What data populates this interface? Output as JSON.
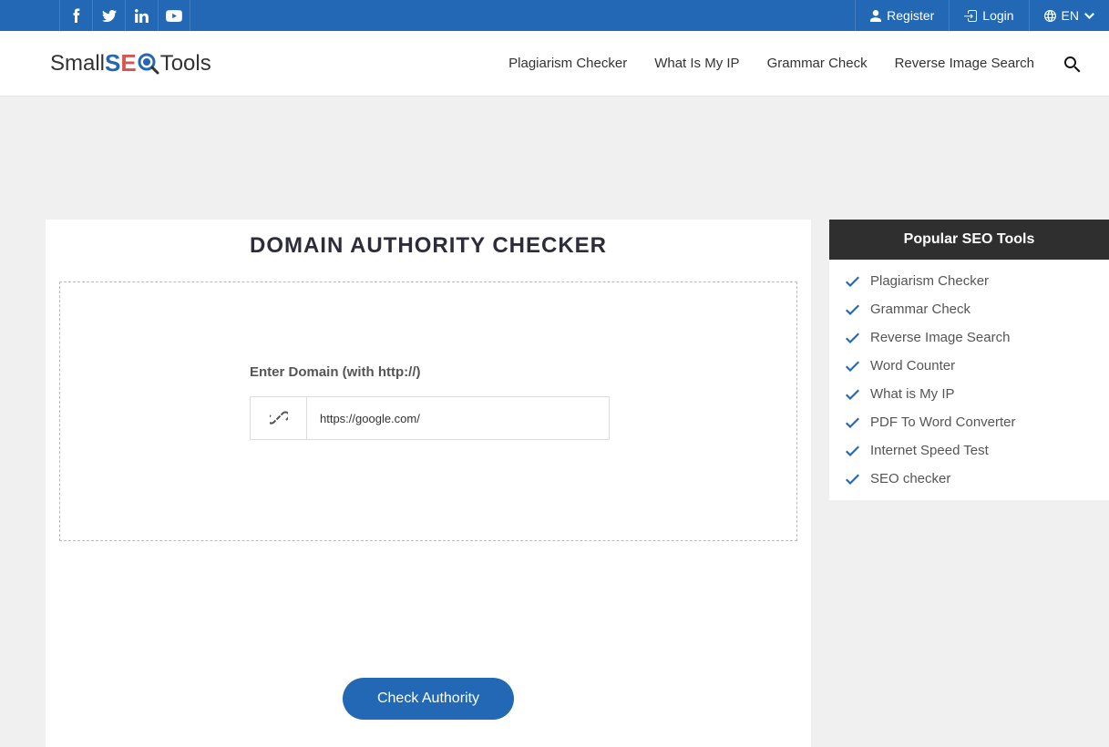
{
  "topbar": {
    "register": "Register",
    "login": "Login",
    "language": "EN"
  },
  "logo": {
    "small": "Small",
    "s": "S",
    "e": "E",
    "tools": "Tools"
  },
  "nav": {
    "links": [
      "Plagiarism Checker",
      "What Is My IP",
      "Grammar Check",
      "Reverse Image Search"
    ]
  },
  "main": {
    "title": "DOMAIN AUTHORITY CHECKER",
    "input_label": "Enter Domain (with http://)",
    "input_value": "https://google.com/",
    "button_label": "Check Authority"
  },
  "sidebar": {
    "header": "Popular SEO Tools",
    "items": [
      "Plagiarism Checker",
      "Grammar Check",
      "Reverse Image Search",
      "Word Counter",
      "What is My IP",
      "PDF To Word Converter",
      "Internet Speed Test",
      "SEO checker"
    ]
  }
}
